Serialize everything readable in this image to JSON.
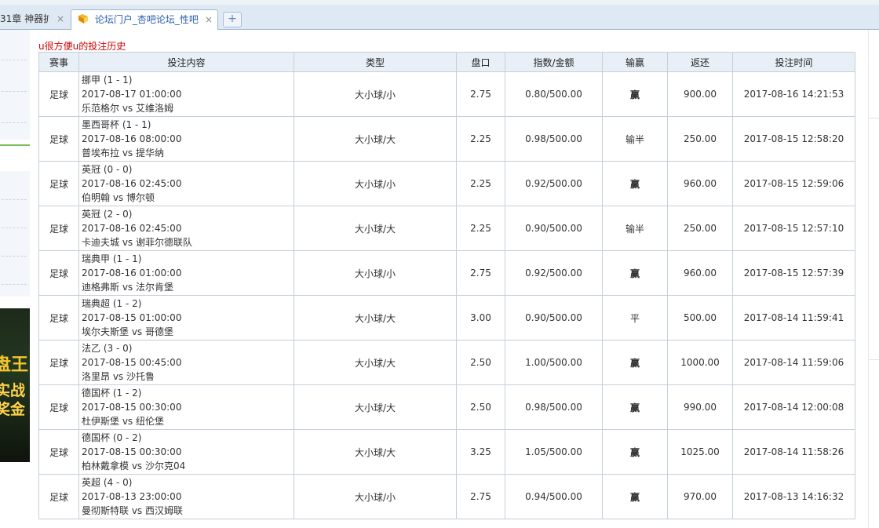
{
  "browser": {
    "tabs": [
      {
        "title": "31章 神器扩",
        "active": false
      },
      {
        "title": "论坛门户_杏吧论坛_性吧",
        "active": true
      }
    ],
    "new_tab_label": "+",
    "close_glyph": "×"
  },
  "page": {
    "history_title": "u很方便u的投注历史"
  },
  "table": {
    "headers": [
      "赛事",
      "投注内容",
      "类型",
      "盘口",
      "指数/金额",
      "输赢",
      "返还",
      "投注时间"
    ],
    "rows": [
      {
        "sport": "足球",
        "league": "挪甲 (1 - 1)",
        "kickoff": "2017-08-17 01:00:00",
        "match": "乐范格尔 vs 艾维洛姆",
        "type": "大小球/小",
        "line": "2.75",
        "odds_amount": "0.80/500.00",
        "result": "赢",
        "result_kind": "win",
        "return": "900.00",
        "bet_time": "2017-08-16 14:21:53"
      },
      {
        "sport": "足球",
        "league": "墨西哥杯 (1 - 1)",
        "kickoff": "2017-08-16 08:00:00",
        "match": "普埃布拉 vs 提华纳",
        "type": "大小球/大",
        "line": "2.25",
        "odds_amount": "0.98/500.00",
        "result": "输半",
        "result_kind": "half",
        "return": "250.00",
        "bet_time": "2017-08-15 12:58:20"
      },
      {
        "sport": "足球",
        "league": "英冠 (0 - 0)",
        "kickoff": "2017-08-16 02:45:00",
        "match": "伯明翰 vs 博尔顿",
        "type": "大小球/小",
        "line": "2.25",
        "odds_amount": "0.92/500.00",
        "result": "赢",
        "result_kind": "win",
        "return": "960.00",
        "bet_time": "2017-08-15 12:59:06"
      },
      {
        "sport": "足球",
        "league": "英冠 (2 - 0)",
        "kickoff": "2017-08-16 02:45:00",
        "match": "卡迪夫城 vs 谢菲尔德联队",
        "type": "大小球/大",
        "line": "2.25",
        "odds_amount": "0.90/500.00",
        "result": "输半",
        "result_kind": "half",
        "return": "250.00",
        "bet_time": "2017-08-15 12:57:10"
      },
      {
        "sport": "足球",
        "league": "瑞典甲 (1 - 1)",
        "kickoff": "2017-08-16 01:00:00",
        "match": "迪格弗斯 vs 法尔肯堡",
        "type": "大小球/小",
        "line": "2.75",
        "odds_amount": "0.92/500.00",
        "result": "赢",
        "result_kind": "win",
        "return": "960.00",
        "bet_time": "2017-08-15 12:57:39"
      },
      {
        "sport": "足球",
        "league": "瑞典超 (1 - 2)",
        "kickoff": "2017-08-15 01:00:00",
        "match": "埃尔夫斯堡 vs 哥德堡",
        "type": "大小球/大",
        "line": "3.00",
        "odds_amount": "0.90/500.00",
        "result": "平",
        "result_kind": "draw",
        "return": "500.00",
        "bet_time": "2017-08-14 11:59:41"
      },
      {
        "sport": "足球",
        "league": "法乙 (3 - 0)",
        "kickoff": "2017-08-15 00:45:00",
        "match": "洛里昂 vs 沙托鲁",
        "type": "大小球/大",
        "line": "2.50",
        "odds_amount": "1.00/500.00",
        "result": "赢",
        "result_kind": "win",
        "return": "1000.00",
        "bet_time": "2017-08-14 11:59:06"
      },
      {
        "sport": "足球",
        "league": "德国杯 (1 - 2)",
        "kickoff": "2017-08-15 00:30:00",
        "match": "杜伊斯堡 vs 纽伦堡",
        "type": "大小球/大",
        "line": "2.50",
        "odds_amount": "0.98/500.00",
        "result": "赢",
        "result_kind": "win",
        "return": "990.00",
        "bet_time": "2017-08-14 12:00:08"
      },
      {
        "sport": "足球",
        "league": "德国杯 (0 - 2)",
        "kickoff": "2017-08-15 00:30:00",
        "match": "柏林戴拿模 vs 沙尔克04",
        "type": "大小球/大",
        "line": "3.25",
        "odds_amount": "1.05/500.00",
        "result": "赢",
        "result_kind": "win",
        "return": "1025.00",
        "bet_time": "2017-08-14 11:58:26"
      },
      {
        "sport": "足球",
        "league": "英超 (4 - 0)",
        "kickoff": "2017-08-13 23:00:00",
        "match": "曼彻斯特联 vs 西汉姆联",
        "type": "大小球/小",
        "line": "2.75",
        "odds_amount": "0.94/500.00",
        "result": "赢",
        "result_kind": "win",
        "return": "970.00",
        "bet_time": "2017-08-13 14:16:32"
      }
    ]
  },
  "left_ad": {
    "lines": [
      "盘王",
      "实战",
      "奖金"
    ]
  },
  "colors": {
    "win": "#d40000",
    "half_loss": "#22b400",
    "title": "#cc0000",
    "header_bg": "#e8eff6",
    "border": "#c5cfd9"
  }
}
